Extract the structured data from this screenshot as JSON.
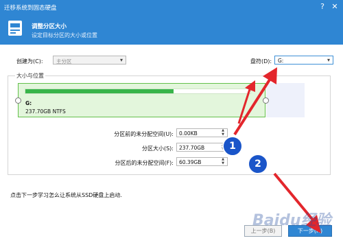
{
  "window": {
    "title": "迁移系统到固态硬盘",
    "help_icon": "?",
    "close_icon": "✕"
  },
  "header": {
    "title": "调整分区大小",
    "subtitle": "设定目标分区的大小或位置"
  },
  "form": {
    "create_as_label": "创建为(C):",
    "create_as_value": "主分区",
    "drive_letter_label": "盘符(D):",
    "drive_letter_value": "G:"
  },
  "group": {
    "legend": "大小与位置"
  },
  "partition": {
    "name": "G:",
    "info": "237.70GB NTFS",
    "used_fraction": 0.66
  },
  "fields": [
    {
      "label": "分区前的未分配空间(U):",
      "value": "0.00KB"
    },
    {
      "label": "分区大小(S):",
      "value": "237.70GB"
    },
    {
      "label": "分区后的未分配空间(F):",
      "value": "60.39GB"
    }
  ],
  "footer": {
    "hint": "点击下一步学习怎么让系统从SSD硬盘上启动."
  },
  "buttons": {
    "prev": "上一步(B)",
    "next": "下一步(N)"
  },
  "annotations": {
    "badge1": "1",
    "badge2": "2",
    "watermark": "Baidu经验"
  },
  "colors": {
    "accent": "#2f86d3",
    "partition_fill": "#38b44a",
    "arrow": "#e3262c",
    "badge": "#1a55c9"
  }
}
